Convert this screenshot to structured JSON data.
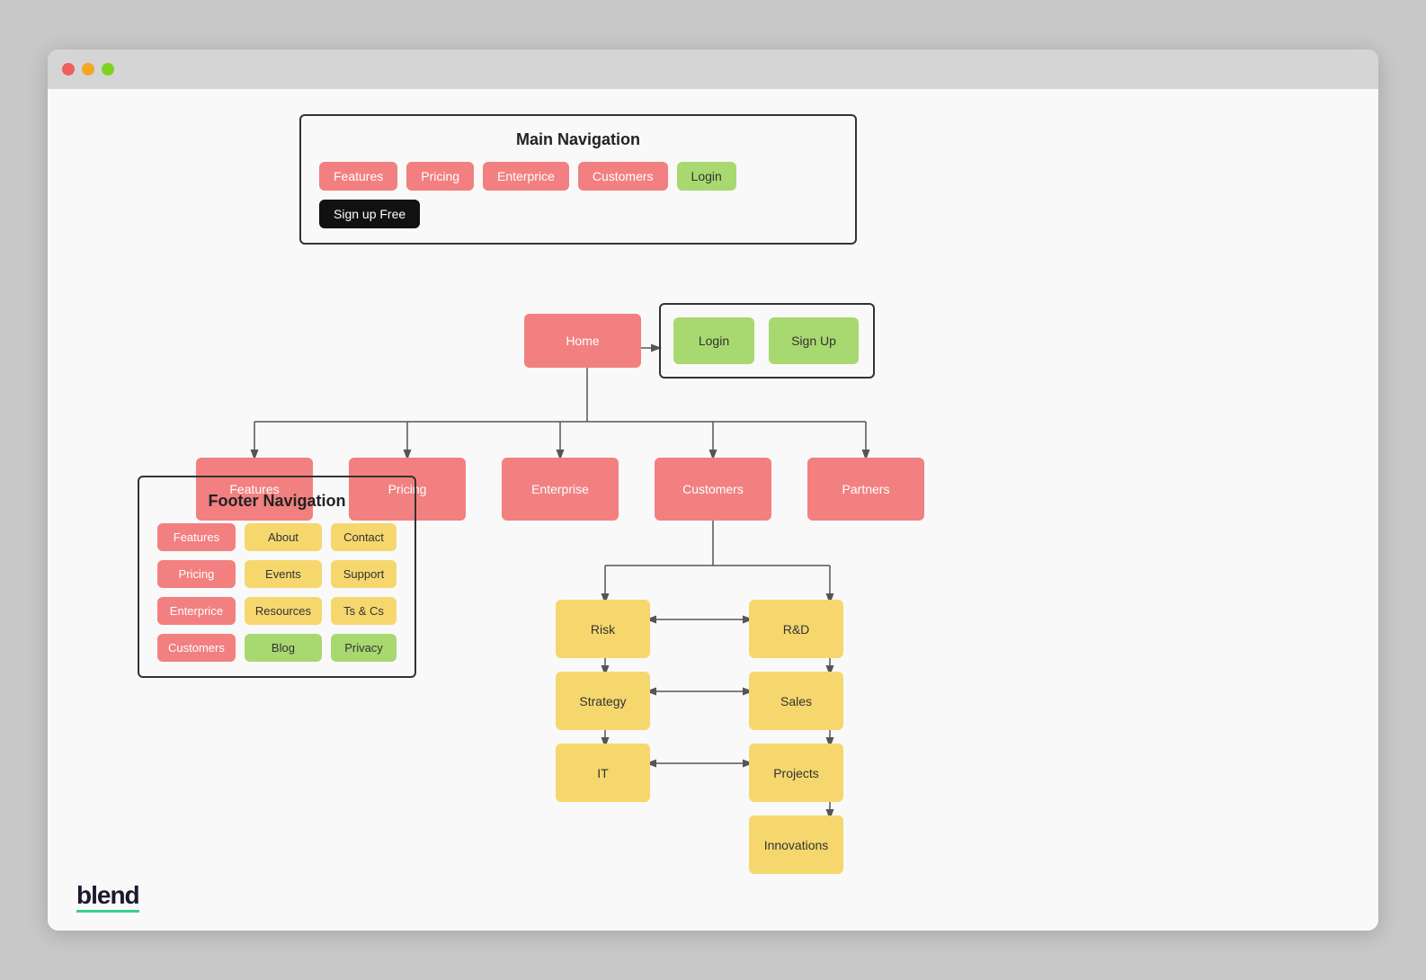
{
  "browser": {
    "dots": [
      "red",
      "yellow",
      "green"
    ]
  },
  "mainNav": {
    "title": "Main Navigation",
    "items": [
      {
        "label": "Features",
        "type": "red"
      },
      {
        "label": "Pricing",
        "type": "red"
      },
      {
        "label": "Enterprice",
        "type": "red"
      },
      {
        "label": "Customers",
        "type": "red"
      },
      {
        "label": "Login",
        "type": "green"
      },
      {
        "label": "Sign up Free",
        "type": "black"
      }
    ]
  },
  "sitemap": {
    "home": "Home",
    "loginGroup": {
      "login": "Login",
      "signup": "Sign Up"
    },
    "level2": [
      {
        "label": "Features"
      },
      {
        "label": "Pricing"
      },
      {
        "label": "Enterprise"
      },
      {
        "label": "Customers"
      },
      {
        "label": "Partners"
      }
    ],
    "customerChildren": {
      "left": [
        "Risk",
        "Strategy",
        "IT"
      ],
      "right": [
        "R&D",
        "Sales",
        "Projects"
      ],
      "bottom": [
        "Innovations"
      ]
    }
  },
  "footerNav": {
    "title": "Footer Navigation",
    "items": [
      {
        "label": "Features",
        "type": "red"
      },
      {
        "label": "About",
        "type": "yellow"
      },
      {
        "label": "Contact",
        "type": "yellow"
      },
      {
        "label": "Pricing",
        "type": "red"
      },
      {
        "label": "Events",
        "type": "yellow"
      },
      {
        "label": "Support",
        "type": "yellow"
      },
      {
        "label": "Enterprice",
        "type": "red"
      },
      {
        "label": "Resources",
        "type": "yellow"
      },
      {
        "label": "Ts & Cs",
        "type": "yellow"
      },
      {
        "label": "Customers",
        "type": "red"
      },
      {
        "label": "Blog",
        "type": "green"
      },
      {
        "label": "Privacy",
        "type": "green"
      }
    ]
  },
  "logo": "blend"
}
